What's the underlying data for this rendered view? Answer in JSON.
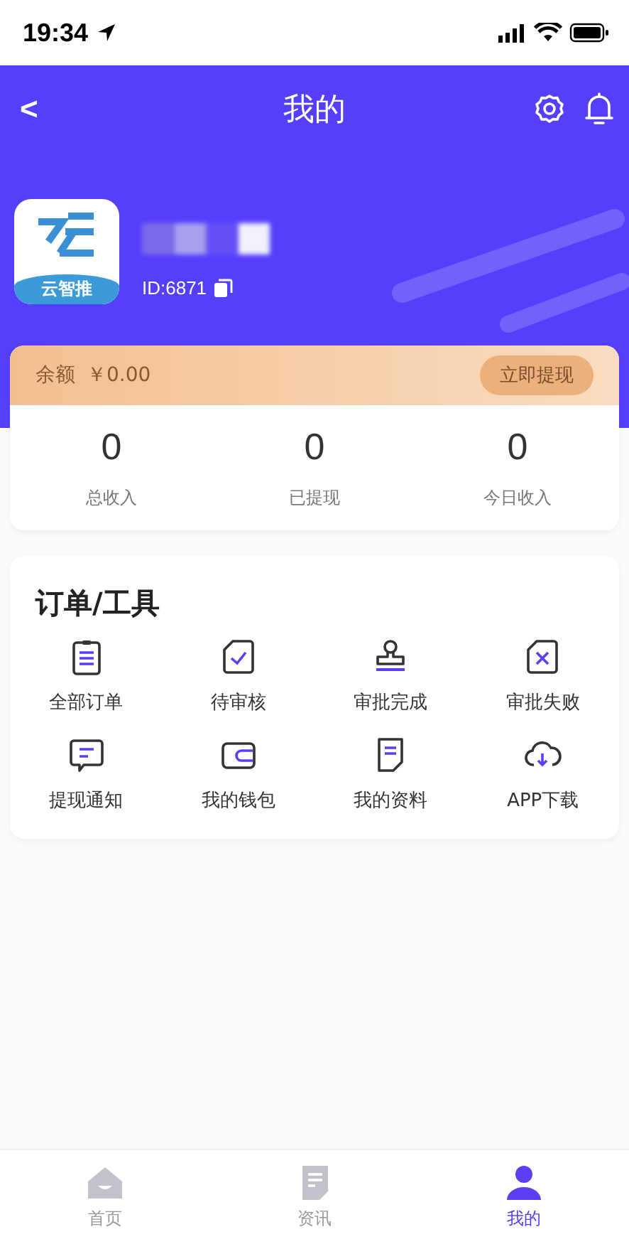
{
  "status_bar": {
    "time": "19:34"
  },
  "header": {
    "back": "<",
    "title": "我的"
  },
  "profile": {
    "logo_text": "云智推",
    "id": "ID:6871"
  },
  "balance": {
    "label": "余额",
    "amount": "￥0.00",
    "button": "立即提现"
  },
  "stats": [
    {
      "value": "0",
      "label": "总收入"
    },
    {
      "value": "0",
      "label": "已提现"
    },
    {
      "value": "0",
      "label": "今日收入"
    }
  ],
  "tools": {
    "title": "订单/工具",
    "items": [
      {
        "label": "全部订单"
      },
      {
        "label": "待审核"
      },
      {
        "label": "审批完成"
      },
      {
        "label": "审批失败"
      },
      {
        "label": "提现通知"
      },
      {
        "label": "我的钱包"
      },
      {
        "label": "我的资料"
      },
      {
        "label": "APP下载"
      }
    ]
  },
  "tab_bar": [
    {
      "label": "首页",
      "selected": false
    },
    {
      "label": "资讯",
      "selected": false
    },
    {
      "label": "我的",
      "selected": true
    }
  ]
}
